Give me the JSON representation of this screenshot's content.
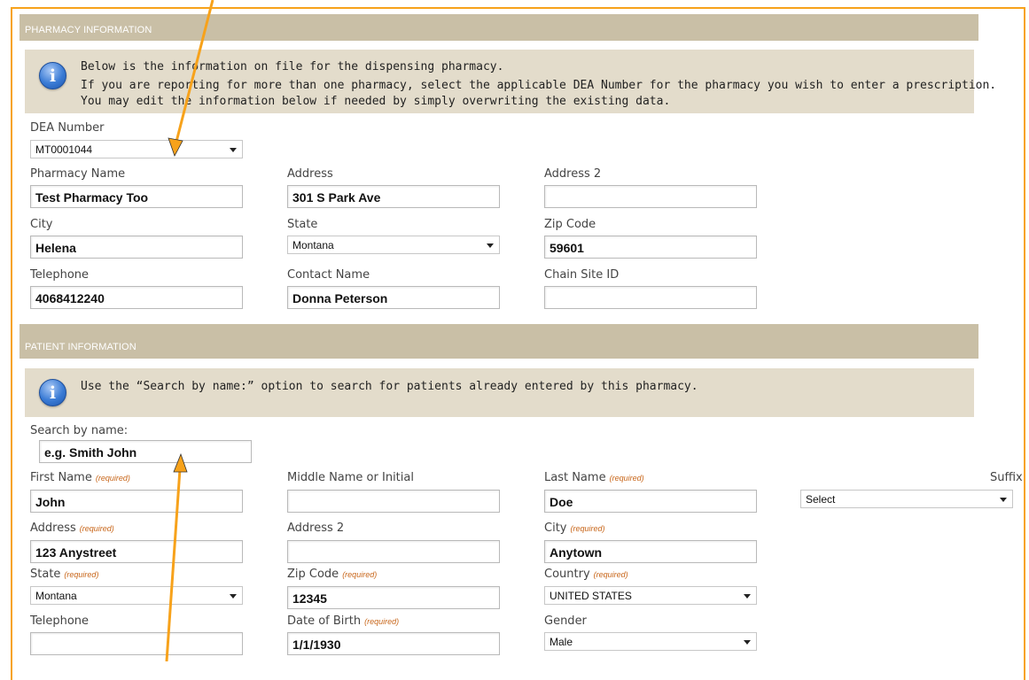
{
  "pharmacy": {
    "section_title": "PHARMACY INFORMATION",
    "info_lines": [
      "Below is the information on file for the dispensing pharmacy.",
      "If you are reporting for more than one pharmacy, select the applicable DEA Number for the pharmacy you wish to enter a prescription.",
      "You may edit the information below if needed by simply overwriting the existing data."
    ],
    "dea_label": "DEA Number",
    "dea_value": "MT0001044",
    "pharmacy_name_label": "Pharmacy Name",
    "pharmacy_name_value": "Test Pharmacy Too",
    "address_label": "Address",
    "address_value": "301 S Park Ave",
    "address2_label": "Address 2",
    "address2_value": "",
    "city_label": "City",
    "city_value": "Helena",
    "state_label": "State",
    "state_value": "Montana",
    "zip_label": "Zip Code",
    "zip_value": "59601",
    "telephone_label": "Telephone",
    "telephone_value": "4068412240",
    "contact_label": "Contact Name",
    "contact_value": "Donna Peterson",
    "chain_label": "Chain Site ID",
    "chain_value": ""
  },
  "patient": {
    "section_title": "PATIENT INFORMATION",
    "info_line": "Use the “Search by name:” option to search for patients already entered by this pharmacy.",
    "search_label": "Search by name:",
    "search_placeholder": "e.g. Smith John",
    "required_text": "(required)",
    "first_name_label": "First Name",
    "first_name_value": "John",
    "middle_label": "Middle Name or Initial",
    "middle_value": "",
    "last_name_label": "Last Name",
    "last_name_value": "Doe",
    "suffix_label": "Suffix",
    "suffix_value": "Select",
    "address_label": "Address",
    "address_value": "123 Anystreet",
    "address2_label": "Address 2",
    "address2_value": "",
    "city_label": "City",
    "city_value": "Anytown",
    "state_label": "State",
    "state_value": "Montana",
    "zip_label": "Zip Code",
    "zip_value": "12345",
    "country_label": "Country",
    "country_value": "UNITED STATES",
    "telephone_label": "Telephone",
    "telephone_value": "",
    "dob_label": "Date of Birth",
    "dob_value": "1/1/1930",
    "gender_label": "Gender",
    "gender_value": "Male"
  },
  "colors": {
    "highlight_border": "#f7a21b",
    "section_bar": "#c9bfa6",
    "info_box": "#e3dccb",
    "required_text": "#c8661a",
    "info_icon": "#3a7bd5"
  },
  "icons": {
    "info": "info-icon",
    "dropdown": "chevron-down-icon",
    "annotation": "arrow-annotation"
  }
}
